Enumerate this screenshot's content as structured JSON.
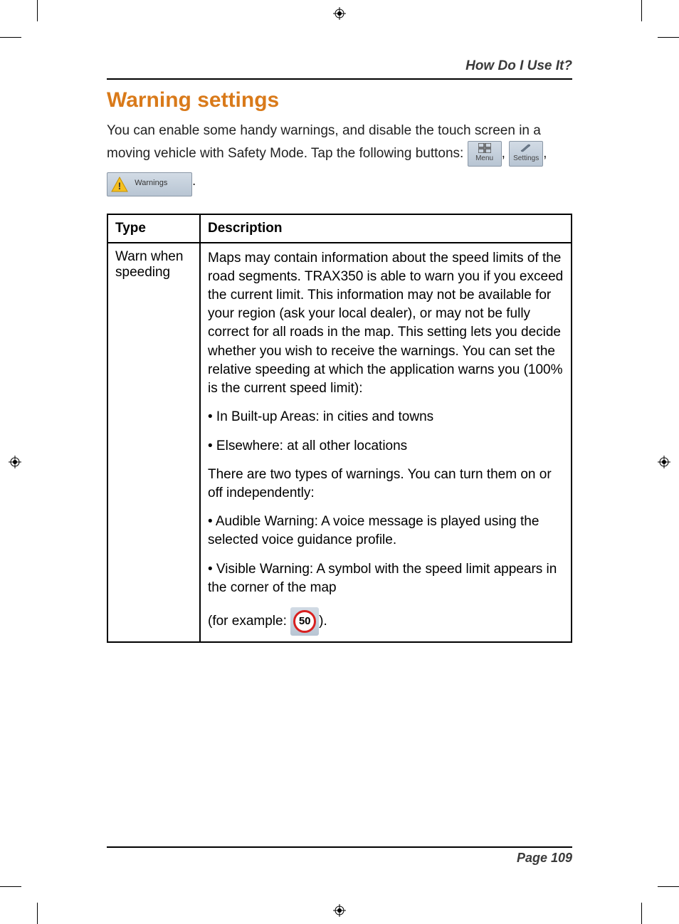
{
  "header": {
    "section_title": "How Do I Use It?"
  },
  "heading": "Warning settings",
  "intro": {
    "text1": "You can enable some handy warnings, and disable the touch screen in a moving vehicle with Safety Mode. Tap the following buttons: ",
    "comma1": ", ",
    "comma2": ",",
    "period": "."
  },
  "buttons": {
    "menu_label": "Menu",
    "settings_label": "Settings",
    "warnings_label": "Warnings"
  },
  "table": {
    "header_type": "Type",
    "header_desc": "Description",
    "row1": {
      "type": "Warn when speeding",
      "p1": "Maps may contain information about the speed limits of the road segments. TRAX350 is able to warn you if you exceed the current limit. This information may not be available for your region (ask your local dealer), or may not be fully correct for all roads in the map. This setting lets you decide whether you wish to receive the warnings. You can set the relative speeding at which the application warns you (100% is the current speed limit):",
      "p2": "• In Built-up Areas: in cities and towns",
      "p3": "• Elsewhere: at all other locations",
      "p4": "There are two types of warnings. You can turn them on or off independently:",
      "p5": "• Audible Warning: A voice message is played using the selected voice guidance profile.",
      "p6": "• Visible Warning: A symbol with the speed limit appears in the corner of the map",
      "p7a": "(for example: ",
      "p7b": ").",
      "speed_value": "50"
    }
  },
  "footer": {
    "page_label": "Page 109"
  }
}
